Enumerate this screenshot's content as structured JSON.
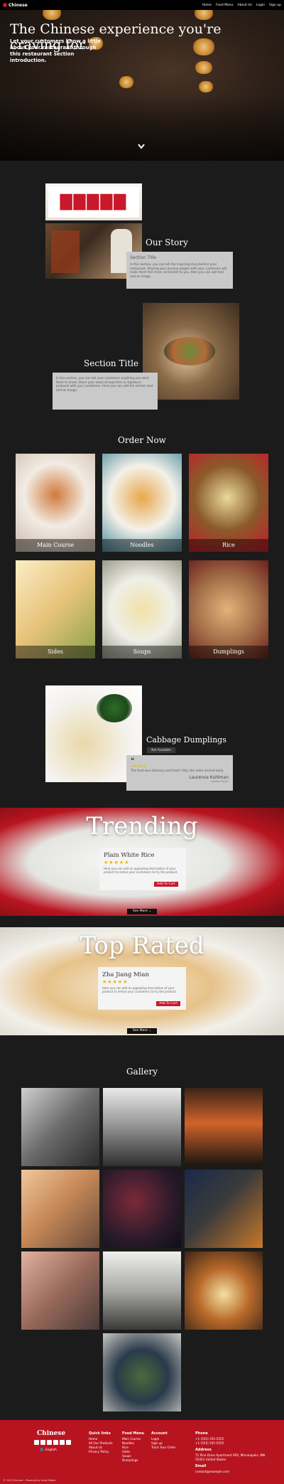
{
  "nav": {
    "brand": "Chinese",
    "links": [
      "Home",
      "Food Menu",
      "About Us",
      "Login",
      "Sign up"
    ]
  },
  "hero": {
    "title": "The Chinese experience you're craving for",
    "subtitle": "Let your customers know a little about your restaurant through this restaurant section introduction.",
    "scroll_icon": "chevron-down-icon"
  },
  "story": {
    "title": "Our Story",
    "box_title": "Section Title",
    "box_body": "In this section, you can tell the inspiring story behind your restaurant. Sharing your journey people with your customers will make them feel more connected to you. Here you can add text and an image."
  },
  "section2": {
    "title": "Section Title",
    "box_body": "In this section, you can tell your customers anything you want them to know. Share your areas of expertise or signature products with your customers. Here you can add the section text and an image."
  },
  "order": {
    "title": "Order Now",
    "items": [
      "Main Course",
      "Noodles",
      "Rice",
      "Sides",
      "Soups",
      "Dumplings"
    ]
  },
  "featured": {
    "name": "Cabbage Dumplings",
    "badge": "Not Available",
    "quote_icon": "quote-icon",
    "review_stars": "★★★★★",
    "review_text": "The food was delicious and fresh! Also, the order arrived early.",
    "reviewer": "Laurence Kuhlman",
    "reviewer_sub": "Verified Buyer"
  },
  "trending": {
    "heading": "Trending",
    "item_name": "Plain White Rice",
    "stars": "★★★★★",
    "description": "Here you can add an appealing description of your product to entice your customers to try the product.",
    "button": "Add To Cart",
    "see_more": "See More"
  },
  "top_rated": {
    "heading": "Top Rated",
    "item_name": "Zha Jiang Mian",
    "stars": "★★★★★",
    "description": "Here you can add an appealing description of your product to entice your customers to try the product.",
    "button": "Add To Cart",
    "see_more": "See More"
  },
  "gallery": {
    "title": "Gallery"
  },
  "footer": {
    "brand": "Chinese",
    "language": "English",
    "quick_links_title": "Quick links",
    "quick_links": [
      "Home",
      "All Our Products",
      "About Us",
      "Privacy Policy"
    ],
    "food_menu_title": "Food Menu",
    "food_menu": [
      "Main Course",
      "Noodles",
      "Rice",
      "Sides",
      "Soups",
      "Dumplings"
    ],
    "account_title": "Account",
    "account": [
      "Login",
      "Sign up",
      "Track Your Order"
    ],
    "phone_title": "Phone",
    "phones": [
      "+1 (555) 555-5555",
      "+1 (555) 555-5555"
    ],
    "address_title": "Address",
    "address": "71 Pine Drive Apartment 905, Minneapolis, MN 55453 United States",
    "email_title": "Email",
    "email": "contact@example.com",
    "copyright": "© 2023 Chinese - Powered by Voice Maker"
  },
  "colors": {
    "accent": "#c8182a",
    "page_bg": "#1b1b1b",
    "footer_bg": "#b8141f",
    "star": "#f0b400"
  }
}
